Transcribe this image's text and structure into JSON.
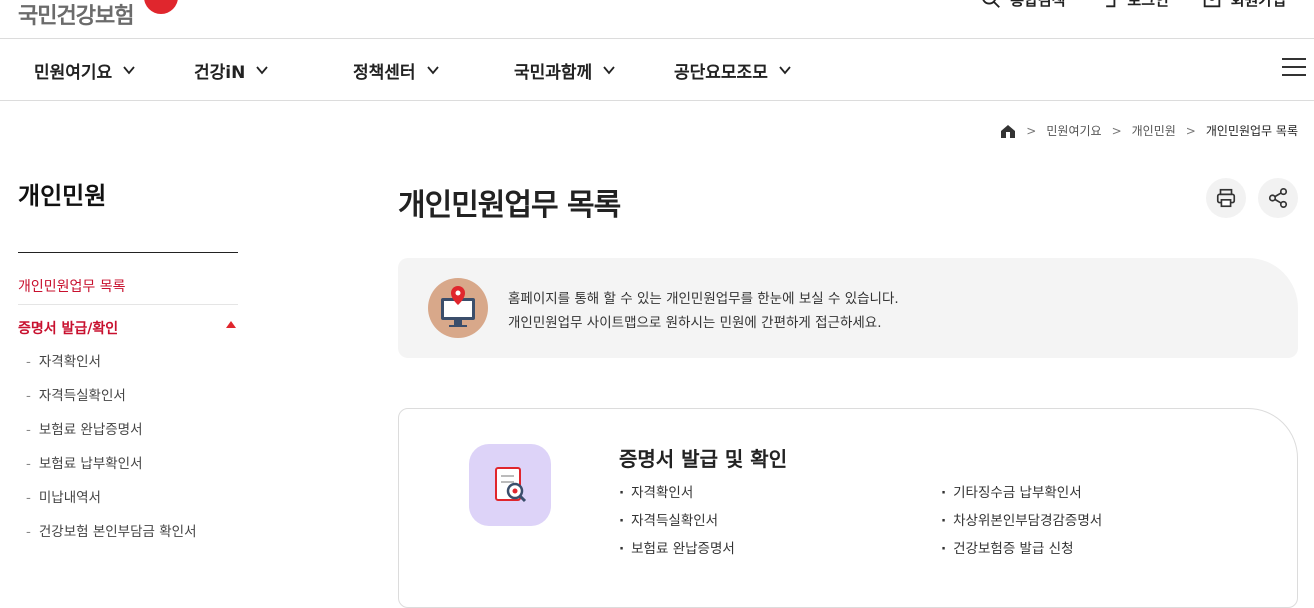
{
  "header": {
    "logo_text": "국민건강보험",
    "utils": [
      {
        "label": "통합검색",
        "icon": "search-icon"
      },
      {
        "label": "로그인",
        "icon": "login-icon"
      },
      {
        "label": "회원가입",
        "icon": "user-icon"
      }
    ]
  },
  "gnb": {
    "items": [
      {
        "label": "민원여기요"
      },
      {
        "label": "건강iN"
      },
      {
        "label": "정책센터"
      },
      {
        "label": "국민과함께"
      },
      {
        "label": "공단요모조모"
      }
    ]
  },
  "breadcrumb": {
    "items": [
      "민원여기요",
      "개인민원"
    ],
    "current": "개인민원업무 목록"
  },
  "lnb": {
    "title": "개인민원",
    "items": [
      {
        "label": "개인민원업무 목록"
      },
      {
        "label": "증명서 발급/확인"
      }
    ],
    "sub_items": [
      "자격확인서",
      "자격득실확인서",
      "보험료 완납증명서",
      "보험료 납부확인서",
      "미납내역서",
      "건강보험 본인부담금 확인서"
    ]
  },
  "main": {
    "title": "개인민원업무 목록",
    "intro_lines": [
      "홈페이지를 통해 할 수 있는 개인민원업무를 한눈에 보실 수 있습니다.",
      "개인민원업무 사이트맵으로 원하시는 민원에 간편하게 접근하세요."
    ],
    "card": {
      "title": "증명서 발급 및 확인",
      "left": [
        "자격확인서",
        "자격득실확인서",
        "보험료 완납증명서"
      ],
      "right": [
        "기타징수금 납부확인서",
        "차상위본인부담경감증명서",
        "건강보험증 발급 신청"
      ]
    }
  },
  "colors": {
    "accent": "#c8102e",
    "intro_bg": "#f4f4f4",
    "card_icon_bg": "#ddd3f8"
  }
}
